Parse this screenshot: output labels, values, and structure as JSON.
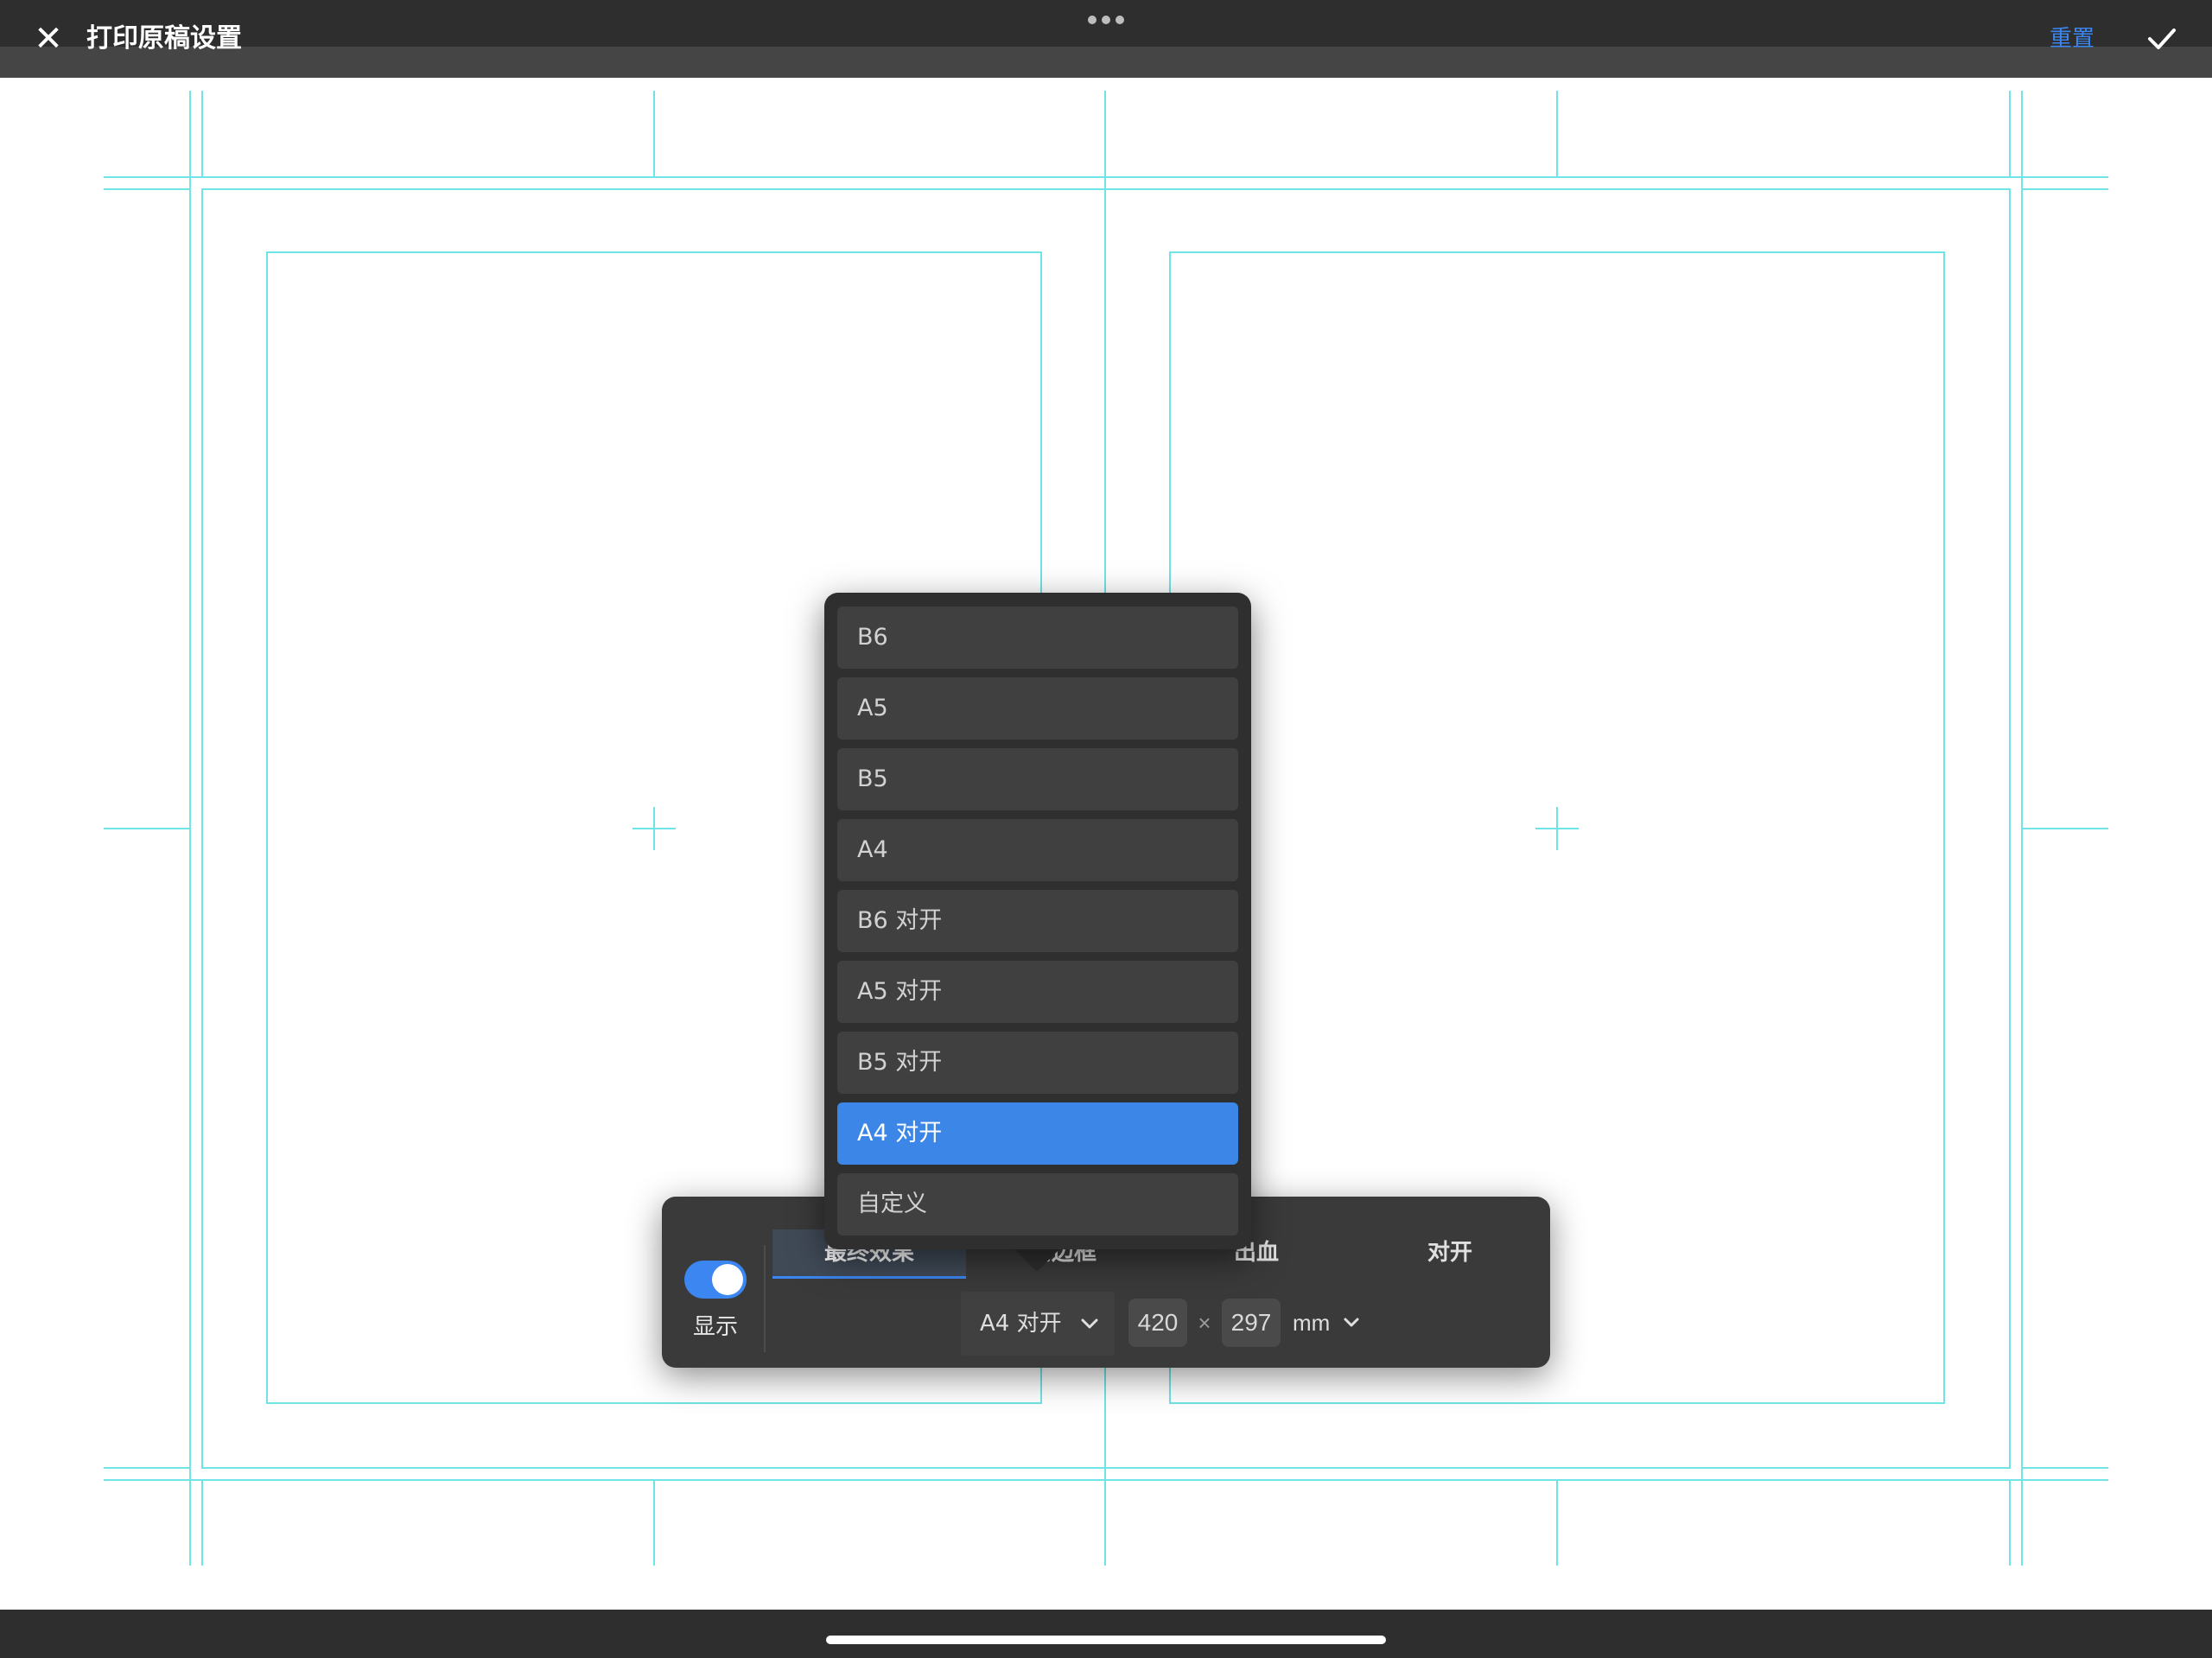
{
  "app": {
    "title": "打印原稿设置"
  },
  "header": {
    "reset_label": "重置"
  },
  "display_toggle": {
    "label": "显示",
    "on": true
  },
  "tabs": [
    {
      "label": "最终效果",
      "active": true
    },
    {
      "label": "内边框",
      "active": false
    },
    {
      "label": "出血",
      "active": false
    },
    {
      "label": "对开",
      "active": false
    }
  ],
  "paper": {
    "selected": "A4 对开",
    "width": "420",
    "times": "×",
    "height": "297",
    "unit": "mm"
  },
  "dropdown": {
    "options": [
      "B6",
      "A5",
      "B5",
      "A4",
      "B6 对开",
      "A5 对开",
      "B5 对开",
      "A4 对开",
      "自定义"
    ],
    "selected_index": 7
  },
  "colors": {
    "accent": "#3b86f0",
    "guide": "#6fe3e6",
    "panel": "#3a3a3a",
    "dropdown": "#2f2f2f"
  }
}
